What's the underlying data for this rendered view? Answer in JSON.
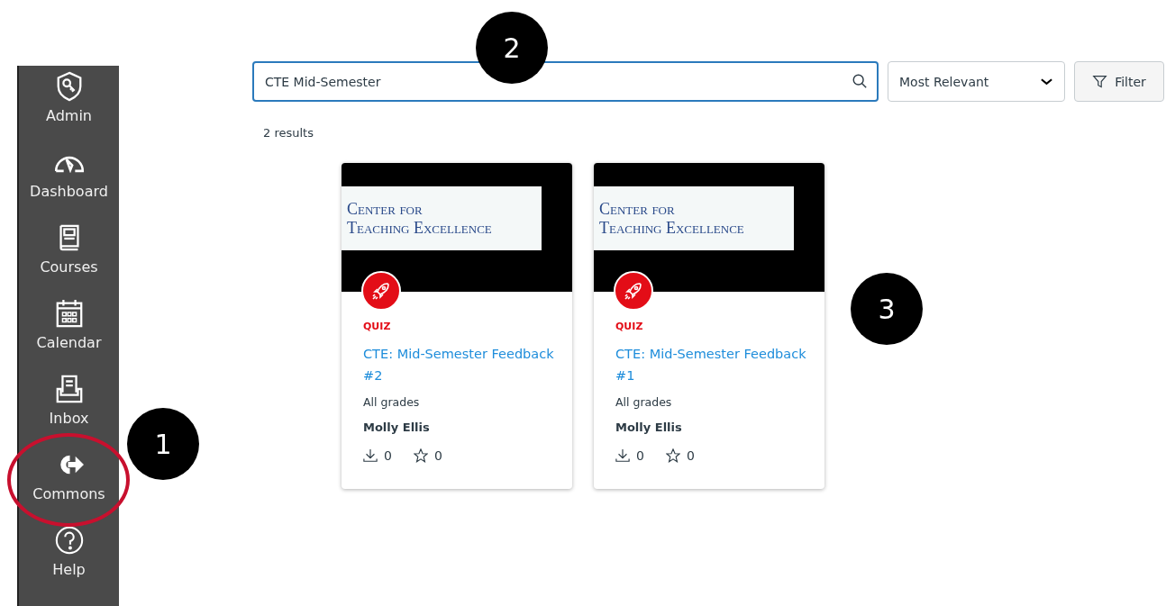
{
  "sidebar": {
    "items": [
      {
        "label": "Admin",
        "highlighted": false
      },
      {
        "label": "Dashboard",
        "highlighted": false
      },
      {
        "label": "Courses",
        "highlighted": false
      },
      {
        "label": "Calendar",
        "highlighted": false
      },
      {
        "label": "Inbox",
        "highlighted": false
      },
      {
        "label": "Commons",
        "highlighted": true
      },
      {
        "label": "Help",
        "highlighted": false
      }
    ]
  },
  "search": {
    "value": "CTE Mid-Semester"
  },
  "sort": {
    "value": "Most Relevant"
  },
  "filter_button": "Filter",
  "result_count": "2 results",
  "cards": [
    {
      "banner_lines": [
        "Center for",
        "Teaching Excellence"
      ],
      "type": "QUIZ",
      "title": "CTE: Mid-Semester Feedback #2",
      "grades": "All grades",
      "author": "Molly Ellis",
      "downloads": "0",
      "favorites": "0"
    },
    {
      "banner_lines": [
        "Center for",
        "Teaching Excellence"
      ],
      "type": "QUIZ",
      "title": "CTE: Mid-Semester Feedback #1",
      "grades": "All grades",
      "author": "Molly Ellis",
      "downloads": "0",
      "favorites": "0"
    }
  ],
  "callouts": [
    "1",
    "2",
    "3"
  ]
}
